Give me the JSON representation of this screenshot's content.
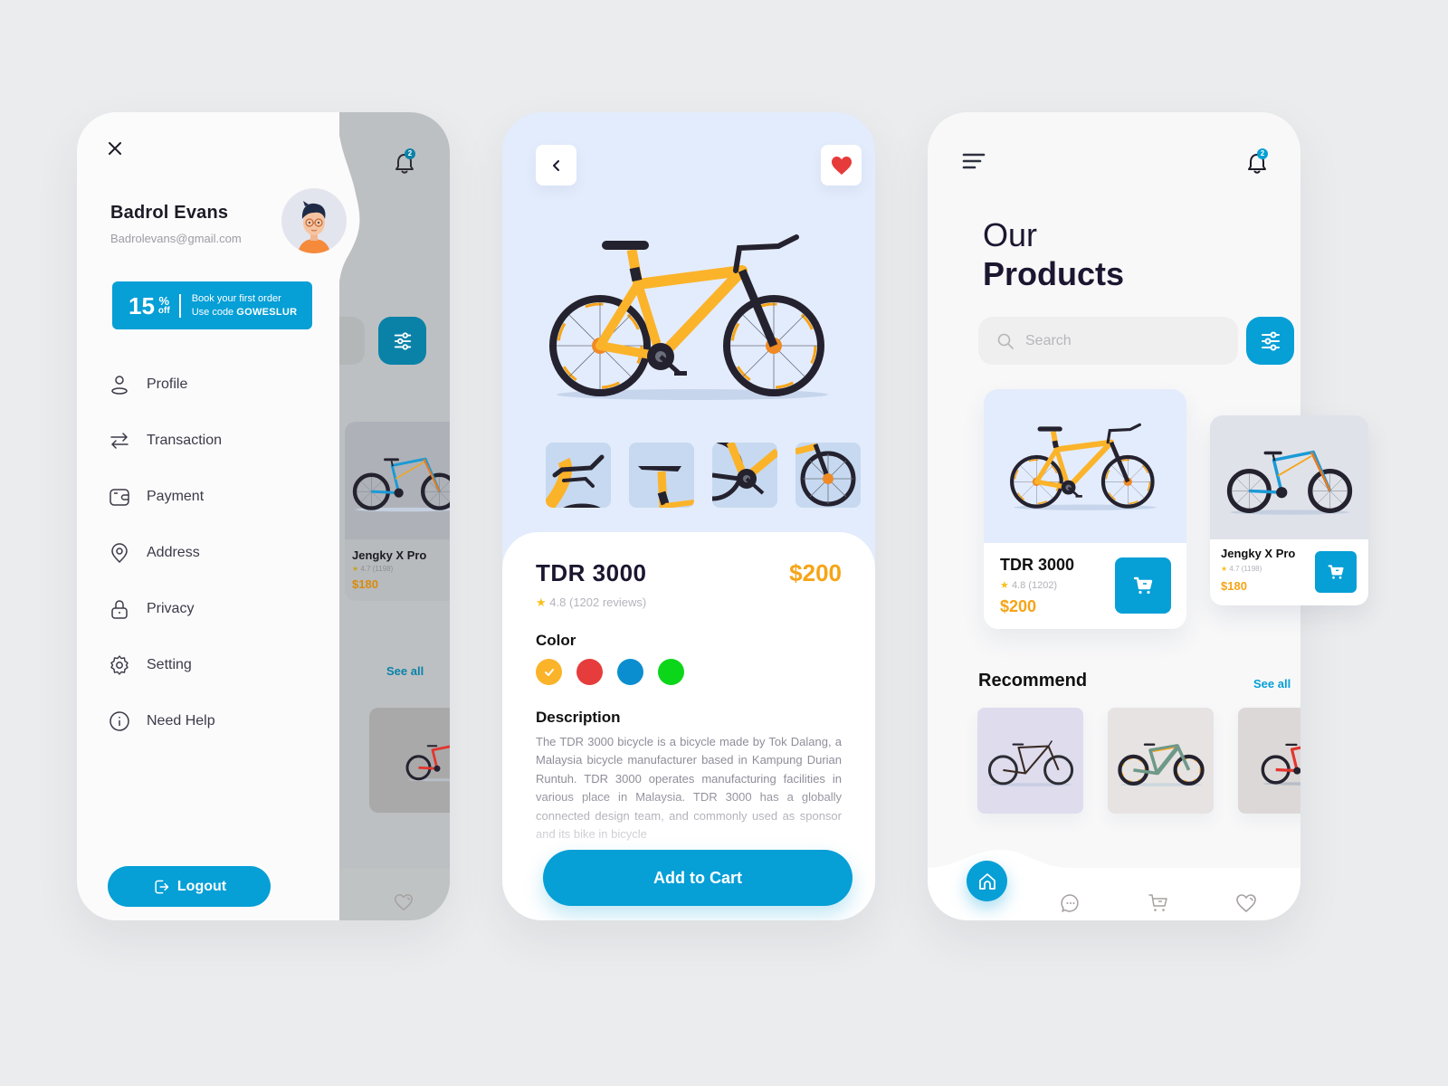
{
  "theme": {
    "accent": "#069fd6",
    "price": "#f6a417",
    "star": "#f9bf1b",
    "text_dark": "#1c1630",
    "background": "#ebecee"
  },
  "drawer": {
    "user": {
      "name": "Badrol Evans",
      "email": "Badrolevans@gmail.com"
    },
    "promo": {
      "value": "15",
      "percent_sign": "%",
      "off_label": "off",
      "line1": "Book your first order",
      "line2_prefix": "Use code ",
      "code": "GOWESLUR"
    },
    "menu": [
      {
        "label": "Profile",
        "icon": "user-icon"
      },
      {
        "label": "Transaction",
        "icon": "transfer-icon"
      },
      {
        "label": "Payment",
        "icon": "wallet-icon"
      },
      {
        "label": "Address",
        "icon": "location-pin-icon"
      },
      {
        "label": "Privacy",
        "icon": "lock-icon"
      },
      {
        "label": "Setting",
        "icon": "gear-icon"
      },
      {
        "label": "Need Help",
        "icon": "info-icon"
      }
    ],
    "logout_label": "Logout",
    "behind": {
      "notification_count": "2",
      "card": {
        "name": "Jengky X Pro",
        "rating": "4.7 (1198)",
        "price": "$180"
      },
      "see_all": "See all"
    }
  },
  "detail": {
    "product": {
      "name": "TDR 3000",
      "price": "$200",
      "rating": "4.8",
      "reviews": "(1202 reviews)"
    },
    "color_label": "Color",
    "colors": [
      {
        "name": "yellow",
        "hex": "#fbb32a",
        "selected": true
      },
      {
        "name": "red",
        "hex": "#e63c3c",
        "selected": false
      },
      {
        "name": "blue",
        "hex": "#0a8ed0",
        "selected": false
      },
      {
        "name": "green",
        "hex": "#0cd61a",
        "selected": false
      }
    ],
    "description_label": "Description",
    "description": "The TDR 3000 bicycle is a bicycle made by Tok Dalang, a Malaysia bicycle manufacturer based in Kampung Durian Runtuh. TDR 3000 operates manufacturing facilities in various place in Malaysia. TDR 3000 has a globally connected design team, and commonly used as sponsor and its bike in bicycle",
    "thumbnails": [
      "handlebar",
      "saddle",
      "crankset",
      "front-wheel"
    ],
    "cta_label": "Add to Cart"
  },
  "products": {
    "notification_count": "2",
    "title_line1": "Our",
    "title_line2": "Products",
    "search_placeholder": "Search",
    "items": [
      {
        "name": "TDR 3000",
        "rating": "4.8",
        "reviews": "(1202)",
        "price": "$200"
      },
      {
        "name": "Jengky X Pro",
        "rating": "4.7",
        "reviews": "(1198)",
        "price": "$180"
      }
    ],
    "recommend_title": "Recommend",
    "see_all": "See all",
    "recommend": [
      {
        "name": "gravel-bike",
        "bg": "#dedced"
      },
      {
        "name": "e-mtb-bike",
        "bg": "#e7e3e2"
      },
      {
        "name": "red-mtb-bike",
        "bg": "#dcd8d7"
      }
    ],
    "nav": [
      "home",
      "chat",
      "cart",
      "favorites"
    ]
  }
}
